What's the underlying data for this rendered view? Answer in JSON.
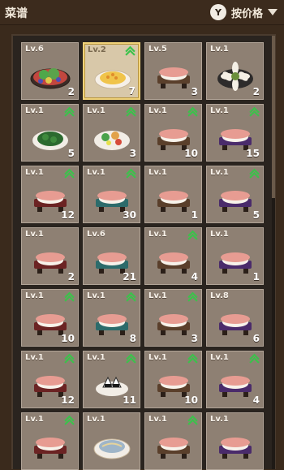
{
  "header": {
    "title": "菜谱",
    "sort_label": "按价格",
    "sort_icon": "sort-y-icon",
    "sort_icon_glyph": "Y"
  },
  "recipes": [
    {
      "level": "Lv.6",
      "count": "2",
      "upgrade": false,
      "selected": false,
      "icon": "salad-platter-icon"
    },
    {
      "level": "Lv.2",
      "count": "7",
      "upgrade": true,
      "selected": true,
      "icon": "omelette-plate-icon"
    },
    {
      "level": "Lv.5",
      "count": "3",
      "upgrade": false,
      "selected": false,
      "icon": "sushi-board-icon"
    },
    {
      "level": "Lv.1",
      "count": "2",
      "upgrade": false,
      "selected": false,
      "icon": "flower-plate-icon"
    },
    {
      "level": "Lv.1",
      "count": "5",
      "upgrade": true,
      "selected": false,
      "icon": "green-dish-icon"
    },
    {
      "level": "Lv.1",
      "count": "3",
      "upgrade": true,
      "selected": false,
      "icon": "vegetable-salad-icon"
    },
    {
      "level": "Lv.1",
      "count": "10",
      "upgrade": true,
      "selected": false,
      "icon": "sushi-board-icon"
    },
    {
      "level": "Lv.1",
      "count": "15",
      "upgrade": true,
      "selected": false,
      "icon": "sushi-board-icon"
    },
    {
      "level": "Lv.1",
      "count": "12",
      "upgrade": true,
      "selected": false,
      "icon": "sushi-board-icon"
    },
    {
      "level": "Lv.1",
      "count": "30",
      "upgrade": true,
      "selected": false,
      "icon": "sushi-board-icon"
    },
    {
      "level": "Lv.1",
      "count": "1",
      "upgrade": false,
      "selected": false,
      "icon": "sushi-board-icon"
    },
    {
      "level": "Lv.1",
      "count": "5",
      "upgrade": true,
      "selected": false,
      "icon": "sushi-board-icon"
    },
    {
      "level": "Lv.1",
      "count": "2",
      "upgrade": false,
      "selected": false,
      "icon": "sushi-board-icon"
    },
    {
      "level": "Lv.6",
      "count": "21",
      "upgrade": false,
      "selected": false,
      "icon": "sushi-board-icon"
    },
    {
      "level": "Lv.1",
      "count": "4",
      "upgrade": true,
      "selected": false,
      "icon": "sushi-board-icon"
    },
    {
      "level": "Lv.1",
      "count": "1",
      "upgrade": false,
      "selected": false,
      "icon": "sushi-board-icon"
    },
    {
      "level": "Lv.1",
      "count": "10",
      "upgrade": true,
      "selected": false,
      "icon": "sushi-board-icon"
    },
    {
      "level": "Lv.1",
      "count": "8",
      "upgrade": true,
      "selected": false,
      "icon": "sushi-board-icon"
    },
    {
      "level": "Lv.1",
      "count": "3",
      "upgrade": true,
      "selected": false,
      "icon": "sushi-board-icon"
    },
    {
      "level": "Lv.8",
      "count": "6",
      "upgrade": false,
      "selected": false,
      "icon": "sushi-board-icon"
    },
    {
      "level": "Lv.1",
      "count": "12",
      "upgrade": true,
      "selected": false,
      "icon": "sushi-board-icon"
    },
    {
      "level": "Lv.1",
      "count": "11",
      "upgrade": true,
      "selected": false,
      "icon": "onigiri-plate-icon"
    },
    {
      "level": "Lv.1",
      "count": "10",
      "upgrade": true,
      "selected": false,
      "icon": "sushi-board-icon"
    },
    {
      "level": "Lv.1",
      "count": "4",
      "upgrade": true,
      "selected": false,
      "icon": "sushi-board-icon"
    },
    {
      "level": "Lv.1",
      "count": "",
      "upgrade": true,
      "selected": false,
      "icon": "sushi-board-icon"
    },
    {
      "level": "Lv.1",
      "count": "",
      "upgrade": false,
      "selected": false,
      "icon": "noodle-bowl-icon"
    },
    {
      "level": "Lv.1",
      "count": "",
      "upgrade": true,
      "selected": false,
      "icon": "sushi-board-icon"
    },
    {
      "level": "Lv.1",
      "count": "",
      "upgrade": false,
      "selected": false,
      "icon": "sushi-board-icon"
    }
  ],
  "colors": {
    "card_bg": "#8e8073",
    "card_selected_bg": "#d8c8a9",
    "upgrade_green": "#3bc24b",
    "board_dark_red": "#6b2323",
    "board_teal": "#2c6b6b",
    "board_brown": "#5a3f2b",
    "board_purple": "#4a2b6b"
  }
}
